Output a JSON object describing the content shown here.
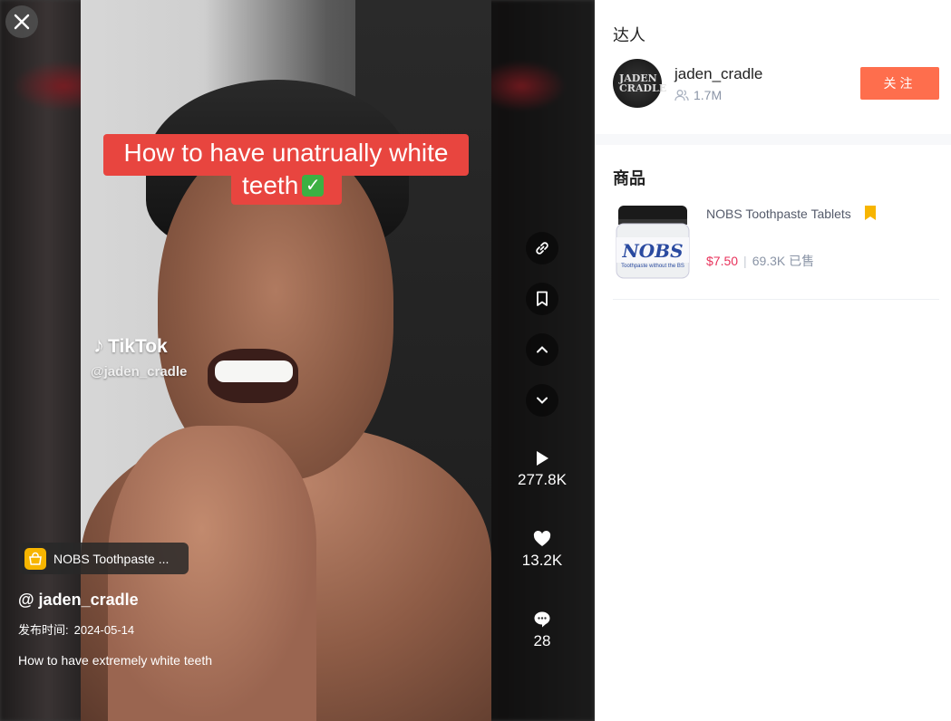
{
  "video": {
    "caption_line1": "How to have unatrually white",
    "caption_line2": "teeth",
    "watermark_brand": "TikTok",
    "watermark_user": "@jaden_cradle",
    "product_pill": "NOBS Toothpaste ...",
    "author": "@ jaden_cradle",
    "publish_label": "发布时间:",
    "publish_date": "2024-05-14",
    "description": "How to have extremely white teeth"
  },
  "stats": {
    "plays": "277.8K",
    "likes": "13.2K",
    "comments": "28"
  },
  "panel": {
    "creator_heading": "达人",
    "creator": {
      "avatar_text": "JADEN CRADLE",
      "name": "jaden_cradle",
      "followers": "1.7M",
      "follow_label": "关注"
    },
    "products_heading": "商品",
    "product": {
      "name": "NOBS Toothpaste Tablets",
      "price": "$7.50",
      "sold": "69.3K 已售",
      "jar_label": "NOBS",
      "jar_sub": "Toothpaste without the BS"
    }
  },
  "colors": {
    "accent_follow": "#fe6e4d",
    "price": "#e8325b",
    "caption_bg": "#e8453f",
    "bookmark": "#f7b500"
  },
  "icons": [
    "close-icon",
    "link-icon",
    "bookmark-icon",
    "chevron-up-icon",
    "chevron-down-icon",
    "play-icon",
    "heart-icon",
    "comment-icon",
    "shopping-bag-icon",
    "followers-icon"
  ]
}
